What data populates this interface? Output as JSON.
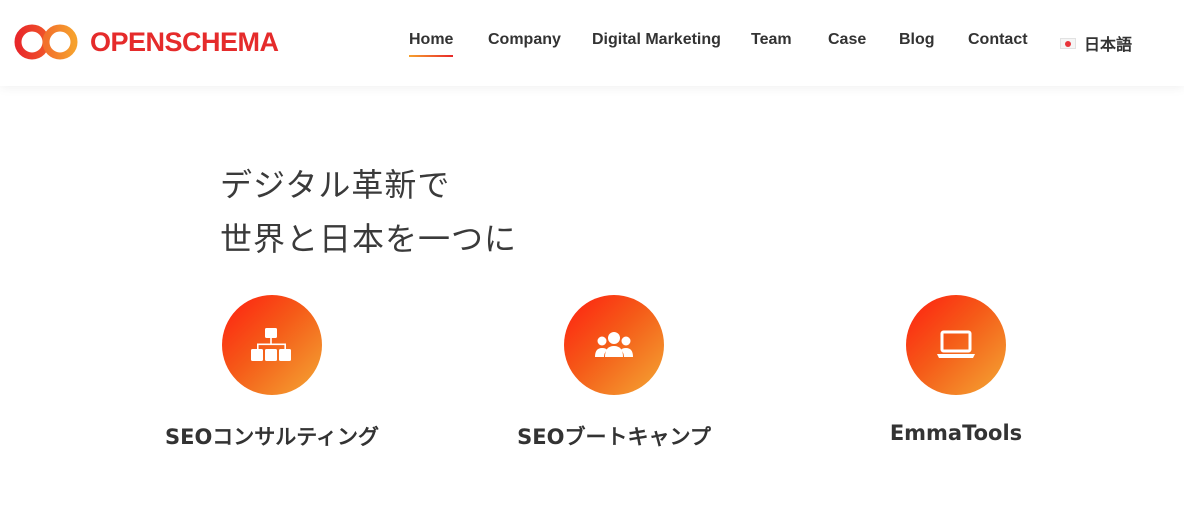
{
  "brand": {
    "name": "OPENSCHEMA",
    "color": "#e52b2b",
    "accent_orange": "#f39a2e"
  },
  "nav": {
    "items": [
      {
        "label": "Home",
        "active": true
      },
      {
        "label": "Company"
      },
      {
        "label": "Digital Marketing"
      },
      {
        "label": "Team"
      },
      {
        "label": "Case"
      },
      {
        "label": "Blog"
      },
      {
        "label": "Contact"
      }
    ],
    "language": {
      "label": "日本語",
      "icon": "japan-flag-icon"
    }
  },
  "hero": {
    "line1": "デジタル革新で",
    "line2": "世界と日本を一つに"
  },
  "services": [
    {
      "title": "SEOコンサルティング",
      "icon": "sitemap-icon"
    },
    {
      "title": "SEOブートキャンプ",
      "icon": "users-group-icon"
    },
    {
      "title": "EmmaTools",
      "icon": "laptop-icon"
    }
  ]
}
